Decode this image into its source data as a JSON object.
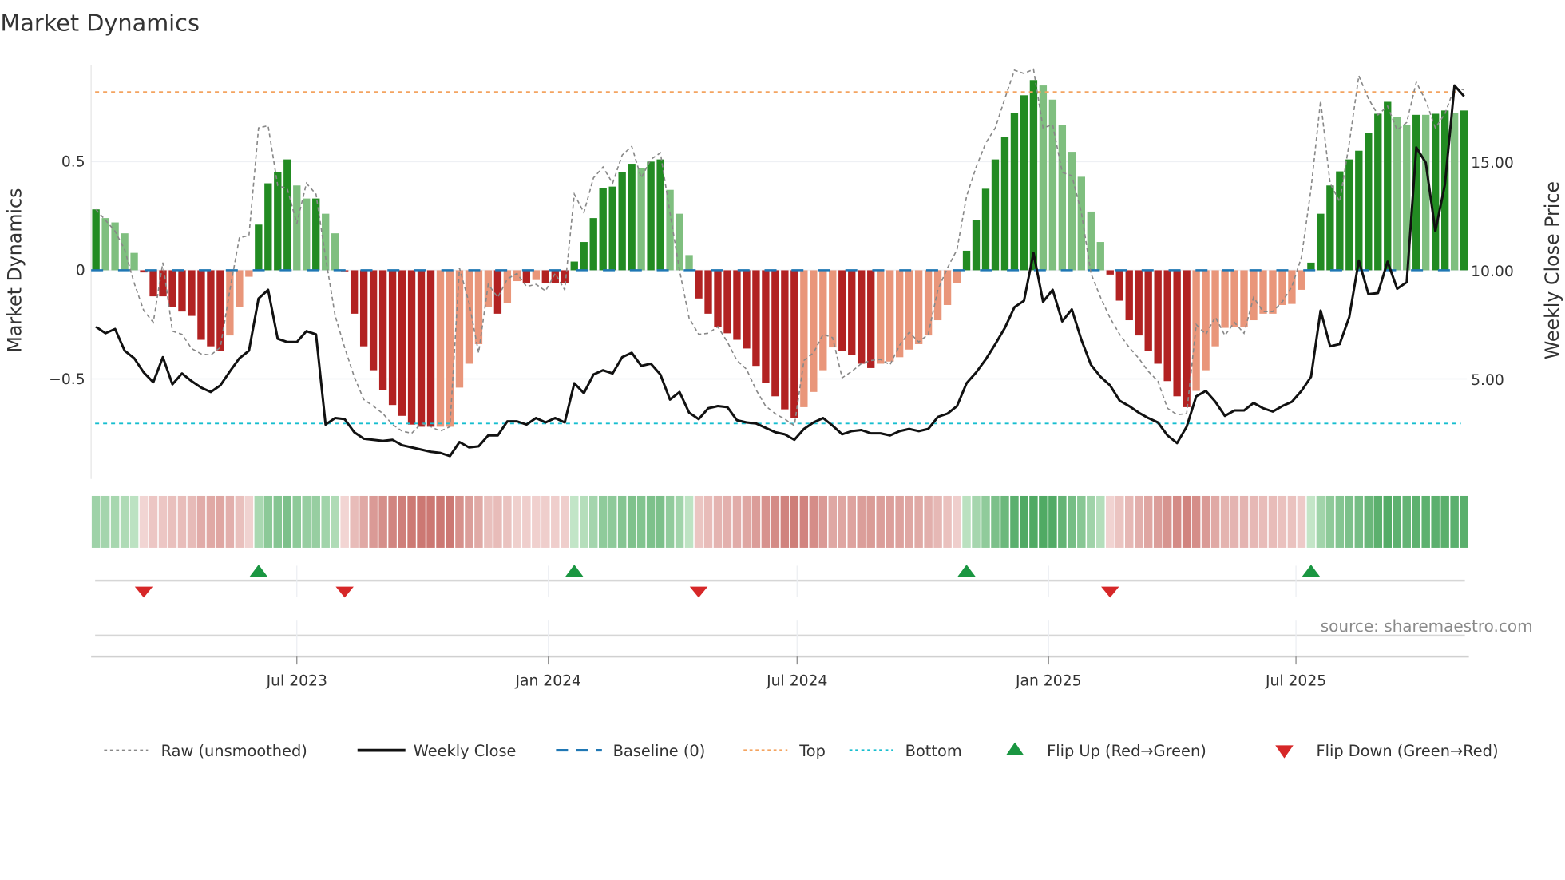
{
  "chart_data": {
    "type": "bar",
    "title": "Market Dynamics",
    "ylabel_left": "Market Dynamics",
    "ylabel_right": "Weekly Close Price",
    "source": "source: sharemaestro.com",
    "start_date": "2023-02-04",
    "frequency": "weekly",
    "ylim_left": [
      -0.96,
      0.945
    ],
    "ylim_right": [
      0.4,
      19.45
    ],
    "left_ticks": [
      {
        "value": 0.5,
        "label": "0.5"
      },
      {
        "value": 0,
        "label": "0"
      },
      {
        "value": -0.5,
        "label": "−0.5"
      }
    ],
    "right_ticks": [
      {
        "value": 15,
        "label": "15.00"
      },
      {
        "value": 10,
        "label": "10.00"
      },
      {
        "value": 5,
        "label": "5.00"
      }
    ],
    "x_ticks": [
      {
        "date": "2023-07-01",
        "label": "Jul 2023"
      },
      {
        "date": "2024-01-01",
        "label": "Jan 2024"
      },
      {
        "date": "2024-07-01",
        "label": "Jul 2024"
      },
      {
        "date": "2025-01-01",
        "label": "Jan 2025"
      },
      {
        "date": "2025-07-01",
        "label": "Jul 2025"
      }
    ],
    "top_level": 0.82,
    "bottom_level": -0.705,
    "baseline": 0,
    "dynamics": [
      0.28,
      0.24,
      0.22,
      0.17,
      0.08,
      -0.01,
      -0.12,
      -0.12,
      -0.17,
      -0.19,
      -0.21,
      -0.32,
      -0.35,
      -0.37,
      -0.3,
      -0.17,
      -0.03,
      0.21,
      0.4,
      0.45,
      0.51,
      0.39,
      0.33,
      0.33,
      0.26,
      0.17,
      -0.005,
      -0.2,
      -0.35,
      -0.46,
      -0.55,
      -0.62,
      -0.67,
      -0.71,
      -0.72,
      -0.72,
      -0.72,
      -0.72,
      -0.54,
      -0.43,
      -0.34,
      -0.17,
      -0.2,
      -0.15,
      -0.05,
      -0.06,
      -0.045,
      -0.06,
      -0.06,
      -0.06,
      0.04,
      0.13,
      0.24,
      0.38,
      0.385,
      0.45,
      0.49,
      0.47,
      0.5,
      0.51,
      0.37,
      0.26,
      0.07,
      -0.13,
      -0.2,
      -0.26,
      -0.29,
      -0.32,
      -0.36,
      -0.44,
      -0.52,
      -0.58,
      -0.64,
      -0.68,
      -0.63,
      -0.56,
      -0.46,
      -0.355,
      -0.37,
      -0.39,
      -0.43,
      -0.45,
      -0.43,
      -0.42,
      -0.4,
      -0.365,
      -0.34,
      -0.3,
      -0.23,
      -0.16,
      -0.06,
      0.09,
      0.23,
      0.375,
      0.51,
      0.615,
      0.725,
      0.805,
      0.875,
      0.85,
      0.785,
      0.67,
      0.545,
      0.43,
      0.27,
      0.13,
      -0.02,
      -0.14,
      -0.23,
      -0.3,
      -0.37,
      -0.43,
      -0.51,
      -0.58,
      -0.63,
      -0.555,
      -0.46,
      -0.35,
      -0.265,
      -0.26,
      -0.26,
      -0.23,
      -0.2,
      -0.2,
      -0.16,
      -0.155,
      -0.09,
      0.035,
      0.26,
      0.39,
      0.455,
      0.51,
      0.55,
      0.63,
      0.72,
      0.775,
      0.705,
      0.67,
      0.715,
      0.715,
      0.72,
      0.735,
      0.725,
      0.735
    ],
    "shade": "SWWWWSSSSSSSSSWWWSSSSWWSWWSSSSSSSSSSWWWWWWSWWSWSSSSSSSSSSWSSWWWSSSSSSSSSSSWWWWSSSSWWWWWWWWWSSSSSSSSWWWWWWWSSSSSSSSSWWWWWWWWWWWWSSSSSSSSSWWSWSSWS",
    "raw": [
      0.28,
      0.23,
      0.18,
      0.095,
      -0.06,
      -0.185,
      -0.24,
      0.035,
      -0.28,
      -0.295,
      -0.36,
      -0.385,
      -0.39,
      -0.355,
      -0.09,
      0.15,
      0.16,
      0.655,
      0.665,
      0.39,
      0.375,
      0.215,
      0.4,
      0.35,
      0.06,
      -0.21,
      -0.355,
      -0.49,
      -0.595,
      -0.625,
      -0.66,
      -0.71,
      -0.74,
      -0.75,
      -0.705,
      -0.72,
      -0.74,
      -0.72,
      0.01,
      -0.15,
      -0.38,
      -0.065,
      -0.125,
      -0.04,
      -0.015,
      -0.075,
      -0.065,
      -0.095,
      -0.015,
      -0.09,
      0.35,
      0.265,
      0.425,
      0.475,
      0.4,
      0.53,
      0.57,
      0.425,
      0.51,
      0.54,
      0.265,
      0.0,
      -0.22,
      -0.295,
      -0.29,
      -0.26,
      -0.33,
      -0.415,
      -0.455,
      -0.55,
      -0.625,
      -0.66,
      -0.685,
      -0.715,
      -0.415,
      -0.38,
      -0.295,
      -0.31,
      -0.495,
      -0.465,
      -0.43,
      -0.415,
      -0.41,
      -0.435,
      -0.345,
      -0.285,
      -0.33,
      -0.295,
      -0.09,
      0.01,
      0.095,
      0.34,
      0.475,
      0.585,
      0.655,
      0.79,
      0.92,
      0.905,
      0.925,
      0.655,
      0.67,
      0.45,
      0.435,
      0.265,
      -0.015,
      -0.125,
      -0.22,
      -0.295,
      -0.355,
      -0.405,
      -0.465,
      -0.51,
      -0.635,
      -0.665,
      -0.66,
      -0.25,
      -0.295,
      -0.215,
      -0.3,
      -0.24,
      -0.29,
      -0.125,
      -0.19,
      -0.19,
      -0.145,
      -0.075,
      0.06,
      0.375,
      0.78,
      0.4,
      0.315,
      0.585,
      0.895,
      0.79,
      0.715,
      0.755,
      0.645,
      0.68,
      0.865,
      0.78,
      0.655,
      0.72,
      0.84,
      0.83
    ],
    "close": [
      7.4,
      7.1,
      7.3,
      6.3,
      5.95,
      5.3,
      4.85,
      6.0,
      4.75,
      5.25,
      4.9,
      4.6,
      4.4,
      4.7,
      5.35,
      5.95,
      6.3,
      8.7,
      9.1,
      6.85,
      6.7,
      6.7,
      7.2,
      7.05,
      2.9,
      3.2,
      3.15,
      2.55,
      2.25,
      2.2,
      2.15,
      2.2,
      1.95,
      1.85,
      1.75,
      1.65,
      1.6,
      1.45,
      2.1,
      1.85,
      1.9,
      2.4,
      2.4,
      3.05,
      3.05,
      2.9,
      3.2,
      3.0,
      3.2,
      3.0,
      4.8,
      4.35,
      5.2,
      5.4,
      5.25,
      6.0,
      6.2,
      5.6,
      5.7,
      5.2,
      4.05,
      4.4,
      3.45,
      3.15,
      3.65,
      3.75,
      3.7,
      3.1,
      3.0,
      2.95,
      2.75,
      2.55,
      2.45,
      2.2,
      2.7,
      3.0,
      3.2,
      2.85,
      2.45,
      2.6,
      2.65,
      2.5,
      2.5,
      2.4,
      2.6,
      2.7,
      2.6,
      2.7,
      3.25,
      3.4,
      3.75,
      4.8,
      5.3,
      5.9,
      6.6,
      7.35,
      8.3,
      8.6,
      10.8,
      8.55,
      9.1,
      7.65,
      8.2,
      6.8,
      5.65,
      5.1,
      4.7,
      4.0,
      3.75,
      3.45,
      3.2,
      3.0,
      2.4,
      2.05,
      2.8,
      4.2,
      4.45,
      3.95,
      3.3,
      3.55,
      3.55,
      3.9,
      3.65,
      3.5,
      3.75,
      3.95,
      4.45,
      5.1,
      8.15,
      6.5,
      6.6,
      7.85,
      10.45,
      8.9,
      8.95,
      10.4,
      9.15,
      9.45,
      15.65,
      14.95,
      11.8,
      13.95,
      18.5,
      18.0
    ],
    "flip_up_weeks": [
      18,
      51,
      92,
      128
    ],
    "flip_down_weeks": [
      6,
      27,
      64,
      107
    ],
    "legend": {
      "position": "bottom",
      "items": [
        {
          "key": "raw",
          "label": "Raw (unsmoothed)"
        },
        {
          "key": "close",
          "label": "Weekly Close"
        },
        {
          "key": "baseline",
          "label": "Baseline (0)"
        },
        {
          "key": "top",
          "label": "Top"
        },
        {
          "key": "bottom",
          "label": "Bottom"
        },
        {
          "key": "flip_up",
          "label": "Flip Up (Red→Green)"
        },
        {
          "key": "flip_down",
          "label": "Flip Down (Green→Red)"
        }
      ]
    },
    "colors": {
      "green_strong": "#228b22",
      "green_weak": "#7fbf7f",
      "red_strong": "#b22222",
      "red_weak": "#e9967a",
      "raw": "#888888",
      "close": "#111111",
      "baseline": "#1f77b4",
      "top": "#f4a460",
      "bottom": "#17becf",
      "flip_up": "#1a9641",
      "flip_down": "#d62728"
    }
  }
}
